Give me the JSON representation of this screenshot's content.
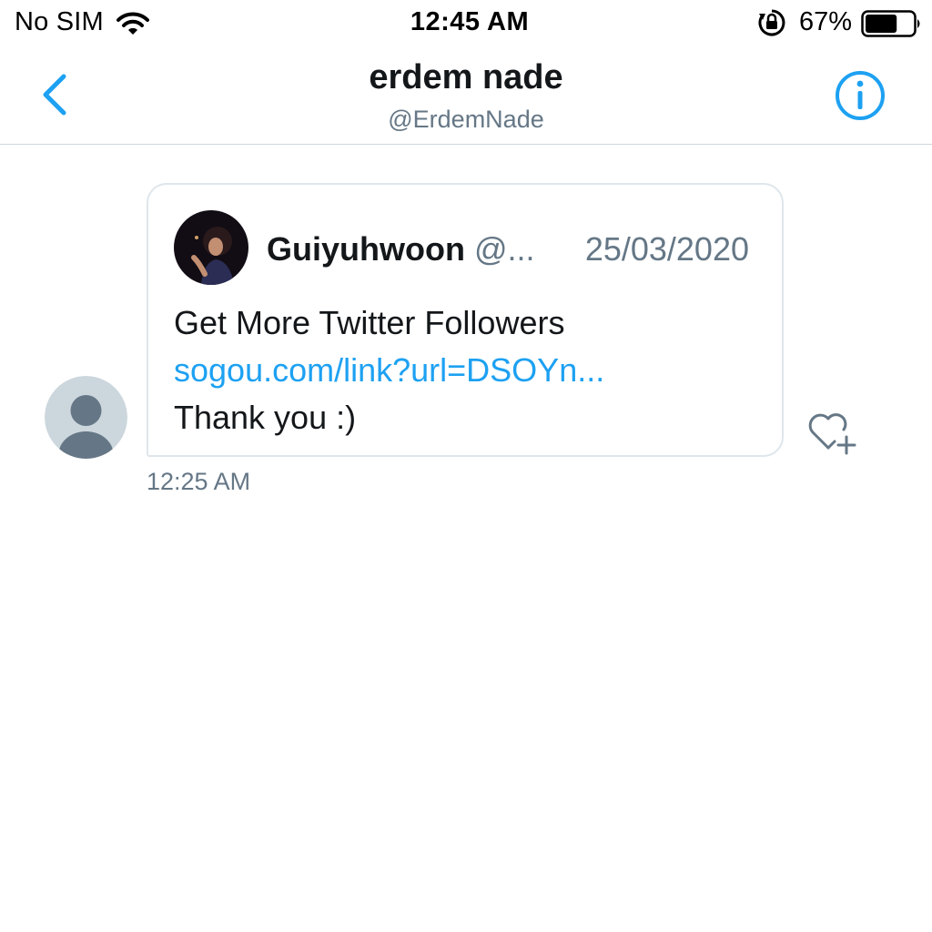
{
  "status_bar": {
    "carrier": "No SIM",
    "time": "12:45 AM",
    "battery_percent": "67%",
    "battery_level": 0.67,
    "icons": [
      "wifi-icon",
      "orientation-lock-icon",
      "battery-icon"
    ]
  },
  "header": {
    "title": "erdem nade",
    "handle": "@ErdemNade",
    "back_icon": "chevron-left-icon",
    "info_icon": "info-icon"
  },
  "conversation": {
    "messages": [
      {
        "tweet": {
          "author": "Guiyuhwoon",
          "handle": "@...",
          "date": "25/03/2020",
          "text_line1": "Get More Twitter Followers",
          "link": "sogou.com/link?url=DSOYn...",
          "text_line3": "Thank you :)"
        },
        "time": "12:25 AM",
        "like_icon": "heart-plus-icon"
      }
    ]
  },
  "colors": {
    "accent": "#1da1f2",
    "text_primary": "#14171a",
    "text_secondary": "#657786",
    "border": "#dfe6eb",
    "avatar_bg": "#ccd6dd",
    "avatar_fg": "#657786"
  }
}
